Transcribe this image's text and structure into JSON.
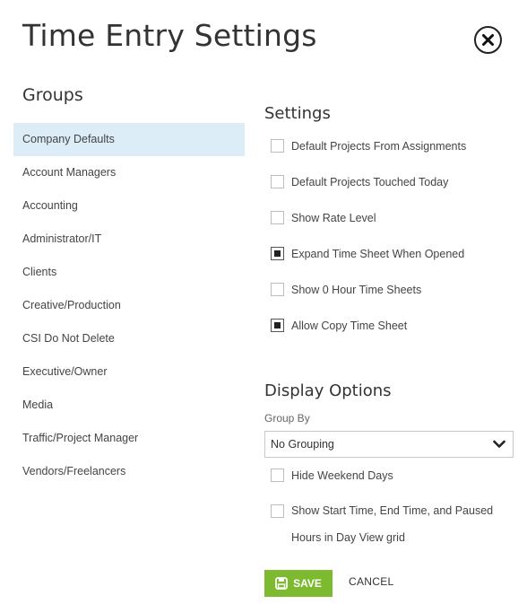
{
  "header": {
    "title": "Time Entry Settings"
  },
  "groups": {
    "heading": "Groups",
    "items": [
      {
        "label": "Company Defaults",
        "active": true
      },
      {
        "label": "Account Managers"
      },
      {
        "label": "Accounting"
      },
      {
        "label": "Administrator/IT"
      },
      {
        "label": "Clients"
      },
      {
        "label": "Creative/Production"
      },
      {
        "label": "CSI Do Not Delete"
      },
      {
        "label": "Executive/Owner"
      },
      {
        "label": "Media"
      },
      {
        "label": "Traffic/Project Manager"
      },
      {
        "label": "Vendors/Freelancers"
      }
    ]
  },
  "settings": {
    "heading": "Settings",
    "options": [
      {
        "label": "Default Projects From Assignments",
        "checked": false
      },
      {
        "label": "Default Projects Touched Today",
        "checked": false
      },
      {
        "label": "Show Rate Level",
        "checked": false
      },
      {
        "label": "Expand Time Sheet When Opened",
        "checked": true
      },
      {
        "label": "Show 0 Hour Time Sheets",
        "checked": false
      },
      {
        "label": "Allow Copy Time Sheet",
        "checked": true
      }
    ]
  },
  "display": {
    "heading": "Display Options",
    "group_by_label": "Group By",
    "group_by_value": "No Grouping",
    "hide_weekend_label": "Hide Weekend Days",
    "hide_weekend_checked": false,
    "show_times_label_line1": "Show Start Time, End Time, and Paused",
    "show_times_label_line2": "Hours in Day View grid",
    "show_times_checked": false
  },
  "actions": {
    "save_label": "SAVE",
    "cancel_label": "CANCEL"
  },
  "colors": {
    "accent_green": "#7dba2f",
    "selected_row": "#dcedf8"
  },
  "icons": {
    "close": "close-circle-icon",
    "save": "floppy-disk-icon",
    "dropdown": "chevron-down-icon"
  }
}
